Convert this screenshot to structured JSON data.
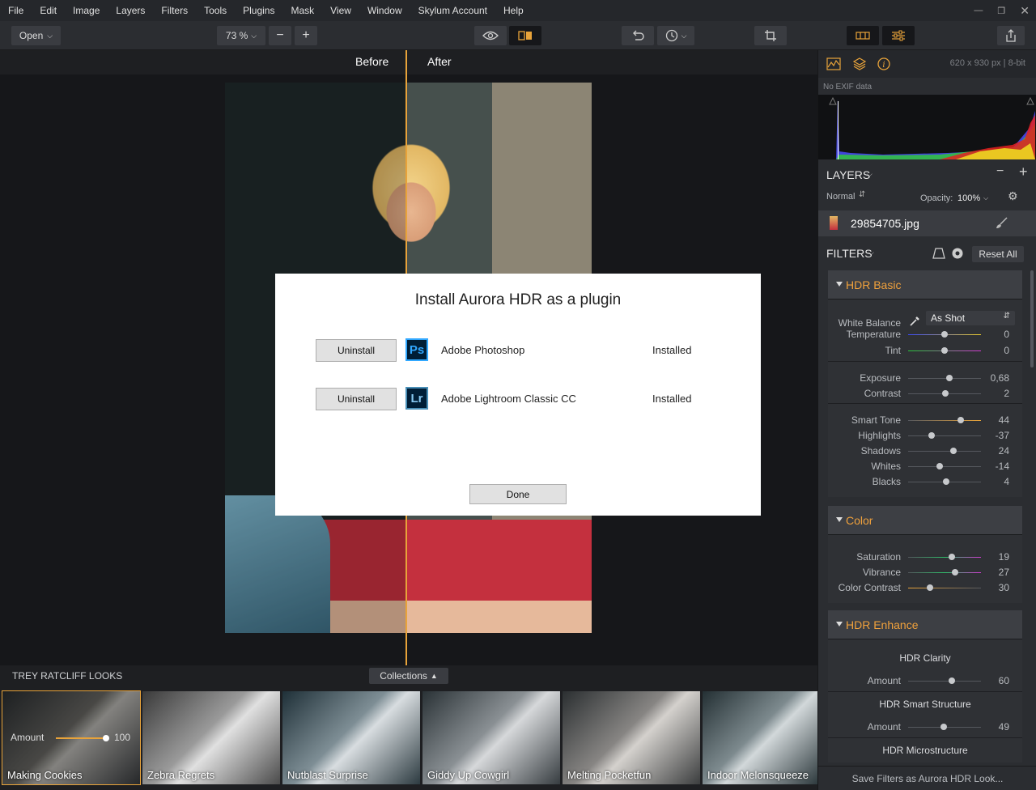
{
  "menu": [
    "File",
    "Edit",
    "Image",
    "Layers",
    "Filters",
    "Tools",
    "Plugins",
    "Mask",
    "View",
    "Window",
    "Skylum Account",
    "Help"
  ],
  "toolbar": {
    "open_label": "Open",
    "zoom_label": "73 %"
  },
  "canvas": {
    "before_label": "Before",
    "after_label": "After"
  },
  "dialog": {
    "title": "Install Aurora HDR as a plugin",
    "apps": [
      {
        "button": "Uninstall",
        "icon": "Ps",
        "name": "Adobe Photoshop",
        "status": "Installed"
      },
      {
        "button": "Uninstall",
        "icon": "Lr",
        "name": "Adobe Lightroom Classic CC",
        "status": "Installed"
      }
    ],
    "done_label": "Done"
  },
  "looks": {
    "title": "TREY RATCLIFF LOOKS",
    "collections_label": "Collections",
    "amount_label": "Amount",
    "amount_value": "100",
    "amount_level": 1.0,
    "items": [
      "Making Cookies",
      "Zebra Regrets",
      "Nutblast Surprise",
      "Giddy Up Cowgirl",
      "Melting Pocketfun",
      "Indoor Melonsqueeze"
    ]
  },
  "panel": {
    "image_info": "620 x 930 px | 8-bit",
    "exif": "No EXIF data",
    "layers_title": "LAYERS",
    "blend_mode": "Normal",
    "opacity_label": "Opacity:",
    "opacity_value": "100%",
    "layer_name": "29854705.jpg",
    "filters_title": "FILTERS",
    "reset_label": "Reset All",
    "save_label": "Save Filters as Aurora HDR Look..."
  },
  "filters": {
    "hdr_basic": {
      "title": "HDR Basic",
      "white_balance_label": "White Balance",
      "white_balance_value": "As Shot",
      "sliders_a": [
        {
          "label": "Temperature",
          "value": "0",
          "level": 0.5
        },
        {
          "label": "Tint",
          "value": "0",
          "level": 0.5
        }
      ],
      "sliders_b": [
        {
          "label": "Exposure",
          "value": "0,68",
          "level": 0.57
        },
        {
          "label": "Contrast",
          "value": "2",
          "level": 0.51
        }
      ],
      "sliders_c": [
        {
          "label": "Smart Tone",
          "value": "44",
          "level": 0.72
        },
        {
          "label": "Highlights",
          "value": "-37",
          "level": 0.32
        },
        {
          "label": "Shadows",
          "value": "24",
          "level": 0.62
        },
        {
          "label": "Whites",
          "value": "-14",
          "level": 0.43
        },
        {
          "label": "Blacks",
          "value": "4",
          "level": 0.52
        }
      ]
    },
    "color": {
      "title": "Color",
      "sliders": [
        {
          "label": "Saturation",
          "value": "19",
          "level": 0.6
        },
        {
          "label": "Vibrance",
          "value": "27",
          "level": 0.64
        },
        {
          "label": "Color Contrast",
          "value": "30",
          "level": 0.3
        }
      ]
    },
    "hdr_enhance": {
      "title": "HDR Enhance",
      "groups": [
        {
          "name": "HDR Clarity",
          "amount_label": "Amount",
          "value": "60",
          "level": 0.6
        },
        {
          "name": "HDR Smart Structure",
          "amount_label": "Amount",
          "value": "49",
          "level": 0.49
        },
        {
          "name": "HDR Microstructure"
        }
      ]
    }
  },
  "colors": {
    "accent": "#e8a33a",
    "panel": "#2b2d31",
    "canvas": "#16171a"
  }
}
